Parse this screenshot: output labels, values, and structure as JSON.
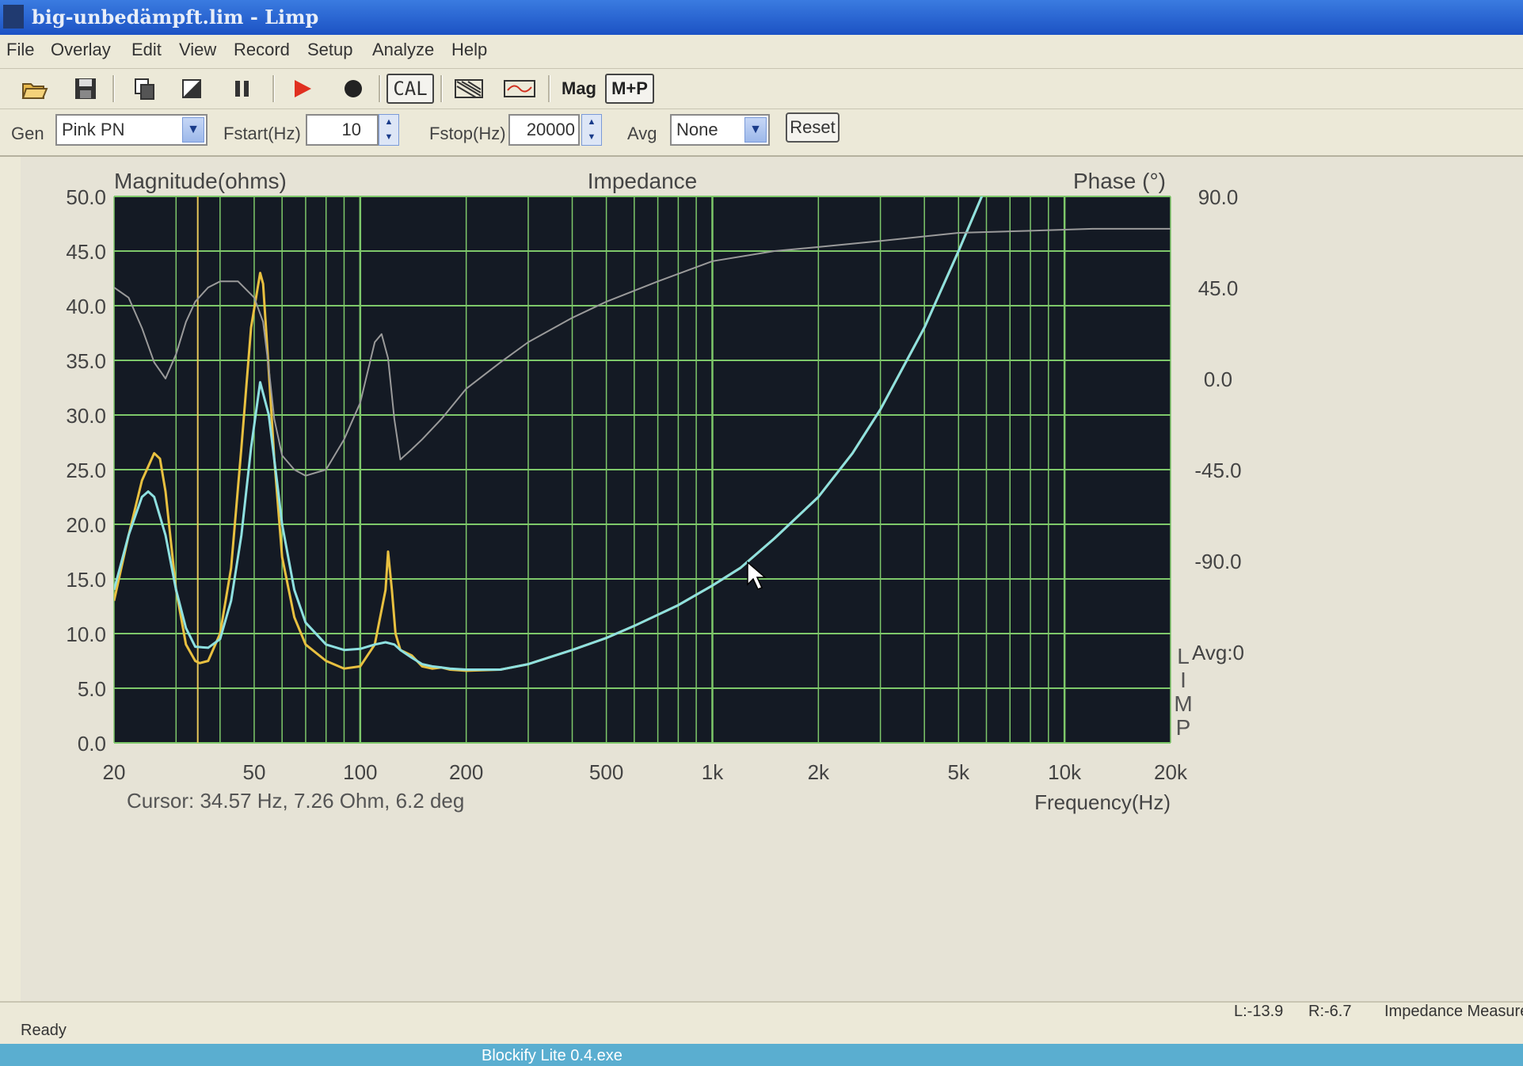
{
  "window": {
    "title": "big-unbedämpft.lim - Limp"
  },
  "menu": [
    "File",
    "Overlay",
    "Edit",
    "View",
    "Record",
    "Setup",
    "Analyze",
    "Help"
  ],
  "toolbar": {
    "icons": [
      "open-folder-icon",
      "save-icon",
      "copy-icon",
      "calibrate-icon",
      "pause-icon",
      "play-icon",
      "record-icon"
    ],
    "cal_label": "CAL",
    "mag_label": "Mag",
    "mp_label": "M+P"
  },
  "generator": {
    "gen_label": "Gen",
    "gen_value": "Pink PN",
    "fstart_label": "Fstart(Hz)",
    "fstart_value": "10",
    "fstop_label": "Fstop(Hz)",
    "fstop_value": "20000",
    "avg_label": "Avg",
    "avg_value": "None",
    "reset_label": "Reset"
  },
  "chart": {
    "ylabel_left": "Magnitude(ohms)",
    "title": "Impedance",
    "ylabel_right": "Phase (°)",
    "xlabel": "Frequency(Hz)",
    "avg_text": "Avg:0",
    "brand_letters": [
      "L",
      "I",
      "M",
      "P"
    ],
    "cursor_text": "Cursor: 34.57 Hz, 7.26 Ohm, 6.2 deg",
    "left_ticks": [
      "50.0",
      "45.0",
      "40.0",
      "35.0",
      "30.0",
      "25.0",
      "20.0",
      "15.0",
      "10.0",
      "5.0",
      "0.0"
    ],
    "right_ticks": [
      "90.0",
      "45.0",
      "0.0",
      "-45.0",
      "-90.0"
    ],
    "x_ticks": [
      {
        "label": "20",
        "f": 20
      },
      {
        "label": "50",
        "f": 50
      },
      {
        "label": "100",
        "f": 100
      },
      {
        "label": "200",
        "f": 200
      },
      {
        "label": "500",
        "f": 500
      },
      {
        "label": "1k",
        "f": 1000
      },
      {
        "label": "2k",
        "f": 2000
      },
      {
        "label": "5k",
        "f": 5000
      },
      {
        "label": "10k",
        "f": 10000
      },
      {
        "label": "20k",
        "f": 20000
      }
    ],
    "colors": {
      "plot_bg": "#141a24",
      "grid": "#7ec86a",
      "cursor": "#e8c85a",
      "magnitude_overlay": "#e8c040",
      "magnitude": "#8ee0e0",
      "phase": "#9a9a9a"
    }
  },
  "chart_data": {
    "type": "line",
    "title": "Impedance",
    "xlabel": "Frequency(Hz)",
    "ylabel": "Magnitude(ohms)",
    "y2label": "Phase (°)",
    "xscale": "log",
    "xlim": [
      20,
      20000
    ],
    "ylim": [
      0,
      50
    ],
    "y2lim": [
      -180,
      90
    ],
    "grid": true,
    "cursor_hz": 34.57,
    "series": [
      {
        "axis": "left",
        "f": [
          20,
          22,
          24,
          26,
          27,
          28,
          30,
          32,
          34,
          35,
          37,
          40,
          43,
          46,
          49,
          52,
          53,
          55,
          57,
          60,
          65,
          70,
          80,
          90,
          100,
          110,
          118,
          120,
          123,
          126,
          130,
          140,
          150,
          160,
          170,
          180,
          200,
          250,
          300,
          400,
          500,
          600,
          800,
          1000,
          1200,
          1500,
          2000,
          2500,
          3000,
          4000,
          5000,
          6000,
          7000,
          8000,
          9000,
          9500
        ],
        "values": [
          13,
          19,
          24,
          26.5,
          26,
          23,
          14,
          9,
          7.5,
          7.3,
          7.5,
          10,
          16,
          27,
          38,
          43,
          42,
          34,
          26,
          17,
          11.5,
          9,
          7.5,
          6.8,
          7,
          9,
          14,
          17.5,
          14,
          10,
          8.5,
          8,
          7,
          6.8,
          6.9,
          6.7,
          6.6,
          6.7,
          7.2,
          8.5,
          9.6,
          10.7,
          12.6,
          14.4,
          16,
          18.7,
          22.5,
          26.5,
          30.5,
          38,
          45,
          51,
          57,
          63,
          68,
          72
        ]
      },
      {
        "axis": "left",
        "f": [
          20,
          22,
          24,
          25,
          26,
          28,
          30,
          32,
          34,
          37,
          40,
          43,
          46,
          49,
          52,
          55,
          58,
          60,
          65,
          70,
          80,
          90,
          100,
          110,
          118,
          125,
          130,
          140,
          150,
          160,
          170,
          180,
          200,
          250,
          300,
          400,
          500,
          600,
          800,
          1000,
          1200,
          1500,
          2000,
          2500,
          3000,
          4000,
          5000,
          6000,
          7000,
          8000,
          9000,
          9500
        ],
        "values": [
          14,
          19,
          22.5,
          23,
          22.5,
          19,
          14,
          10.5,
          8.8,
          8.7,
          9.5,
          13,
          19,
          27,
          33,
          30,
          24,
          20,
          14,
          11,
          9,
          8.5,
          8.6,
          9,
          9.2,
          9,
          8.5,
          7.8,
          7.2,
          7,
          6.9,
          6.8,
          6.7,
          6.7,
          7.2,
          8.5,
          9.6,
          10.7,
          12.6,
          14.4,
          16,
          18.7,
          22.5,
          26.5,
          30.5,
          38,
          45,
          51,
          57,
          63,
          68,
          72
        ]
      },
      {
        "axis": "right",
        "f": [
          20,
          22,
          24,
          26,
          28,
          30,
          32,
          34,
          37,
          40,
          45,
          50,
          53,
          55,
          57,
          60,
          65,
          70,
          80,
          90,
          100,
          110,
          115,
          120,
          125,
          130,
          140,
          150,
          170,
          200,
          250,
          300,
          400,
          500,
          700,
          1000,
          1500,
          2000,
          3000,
          5000,
          8000,
          12000,
          20000
        ],
        "values": [
          45,
          40,
          25,
          8,
          0,
          12,
          28,
          38,
          45,
          48,
          48,
          40,
          28,
          5,
          -20,
          -38,
          -45,
          -48,
          -45,
          -30,
          -12,
          18,
          22,
          10,
          -20,
          -40,
          -35,
          -30,
          -20,
          -5,
          8,
          18,
          30,
          38,
          48,
          58,
          63,
          65,
          68,
          72,
          73,
          74,
          74
        ]
      }
    ]
  },
  "status": {
    "ready": "Ready",
    "levels_l": "L:-13.9",
    "levels_r": "R:-6.7",
    "mode": "Impedance Measure"
  },
  "taskbar": {
    "item": "Blockify Lite 0.4.exe"
  }
}
